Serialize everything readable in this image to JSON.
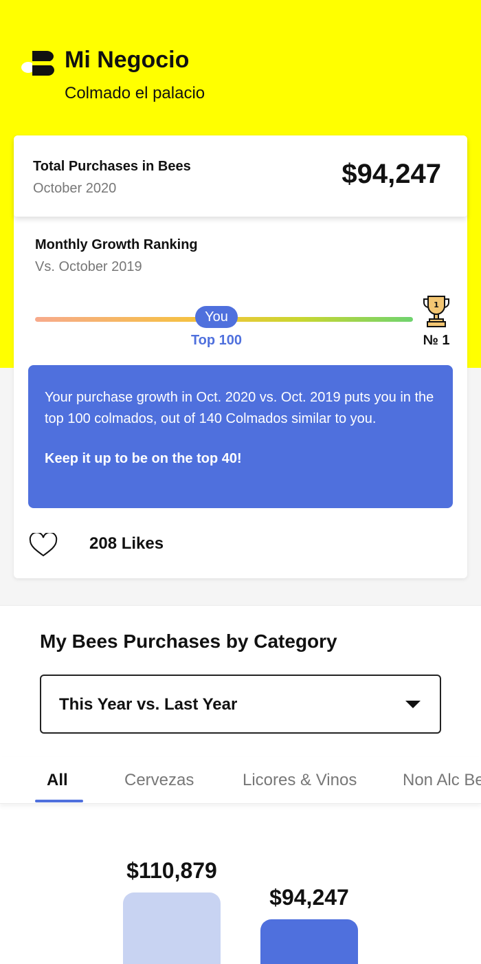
{
  "header": {
    "app_title": "Mi Negocio",
    "store_name": "Colmado el palacio"
  },
  "summary": {
    "total_label": "Total Purchases in Bees",
    "period": "October 2020",
    "amount": "$94,247"
  },
  "ranking": {
    "title": "Monthly Growth Ranking",
    "comparison": "Vs. October 2019",
    "you_label": "You",
    "position_label": "Top 100",
    "first_label": "№ 1",
    "trophy_number": "1",
    "progress": 0.48
  },
  "info": {
    "text": "Your purchase growth in Oct. 2020 vs. Oct. 2019 puts you in the top 100 colmados, out of 140 Colmados similar to you.",
    "cta": "Keep it up to be on the top 40!"
  },
  "likes": {
    "label": "208 Likes"
  },
  "category": {
    "title": "My Bees Purchases by Category",
    "selected_period": "This Year vs. Last Year",
    "tabs": [
      {
        "label": "All",
        "active": true
      },
      {
        "label": "Cervezas",
        "active": false
      },
      {
        "label": "Licores & Vinos",
        "active": false
      },
      {
        "label": "Non Alc Be",
        "active": false
      }
    ]
  },
  "chart_data": {
    "type": "bar",
    "categories": [
      "",
      ""
    ],
    "values": [
      110879,
      94247
    ],
    "value_labels": [
      "$110,879",
      "$94,247"
    ],
    "colors": [
      "#c8d3f2",
      "#4f70dd"
    ]
  },
  "colors": {
    "brand_yellow": "#ffff00",
    "accent_blue": "#4f70dd"
  }
}
